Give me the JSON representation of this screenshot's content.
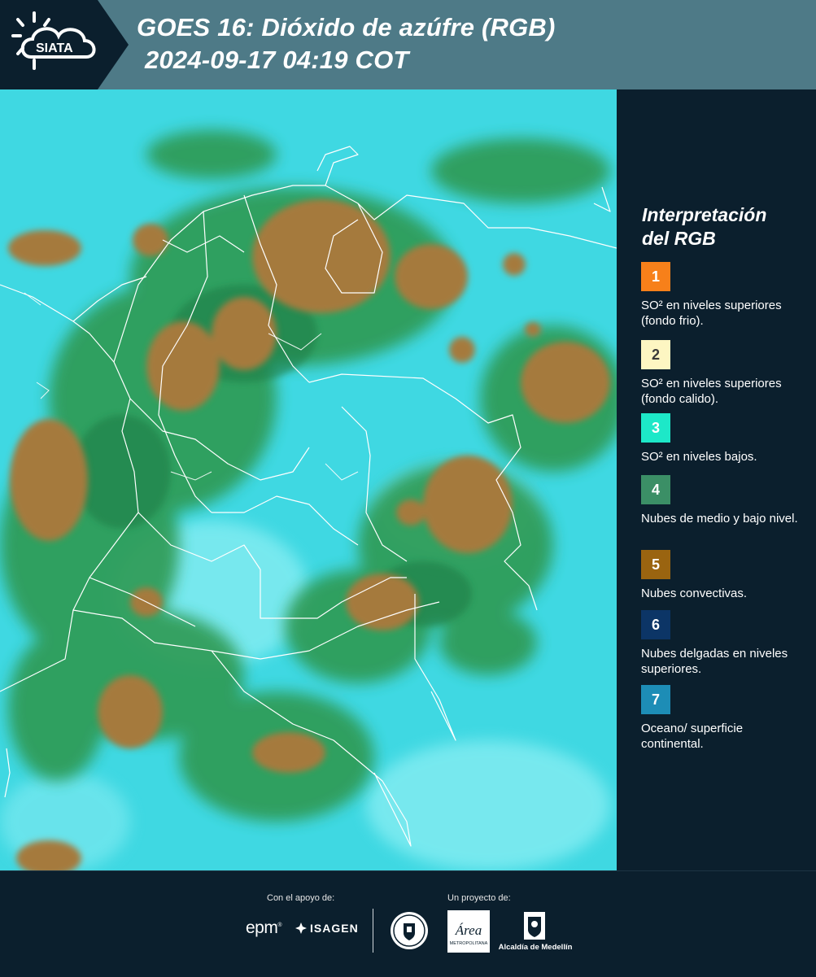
{
  "header": {
    "logo_text": "SIATA",
    "title_line1": "GOES 16: Dióxido de azúfre (RGB)",
    "title_line2": "2024-09-17 04:19 COT"
  },
  "legend": {
    "title_line1": "Interpretación",
    "title_line2": "del RGB",
    "items": [
      {
        "number": "1",
        "color": "#f7801a",
        "label": "SO² en niveles superiores (fondo frio)."
      },
      {
        "number": "2",
        "color": "#fdf6c2",
        "label": "SO² en niveles superiores (fondo calido)."
      },
      {
        "number": "3",
        "color": "#1de8c8",
        "label": "SO² en niveles bajos."
      },
      {
        "number": "4",
        "color": "#3b8f66",
        "label": "Nubes de medio y bajo nivel."
      },
      {
        "number": "5",
        "color": "#9a6410",
        "label": "Nubes convectivas."
      },
      {
        "number": "6",
        "color": "#0c3566",
        "label": "Nubes delgadas en niveles superiores."
      },
      {
        "number": "7",
        "color": "#1d8db6",
        "label": "Oceano/ superficie continental."
      }
    ]
  },
  "footer": {
    "support_label": "Con el apoyo de:",
    "project_label": "Un proyecto de:",
    "epm_logo": "epm",
    "isagen_logo": "ISAGEN",
    "amva_logo": "Área",
    "amva_subtitle": "METROPOLITANA",
    "alcaldia_logo": "Alcaldía de Medellín"
  },
  "colors": {
    "background": "#0b1f2d",
    "header": "#4e7a87",
    "map_base": "#3ad6e0",
    "cloud_green": "#2f9a52",
    "cloud_convective": "#a57a3c"
  }
}
